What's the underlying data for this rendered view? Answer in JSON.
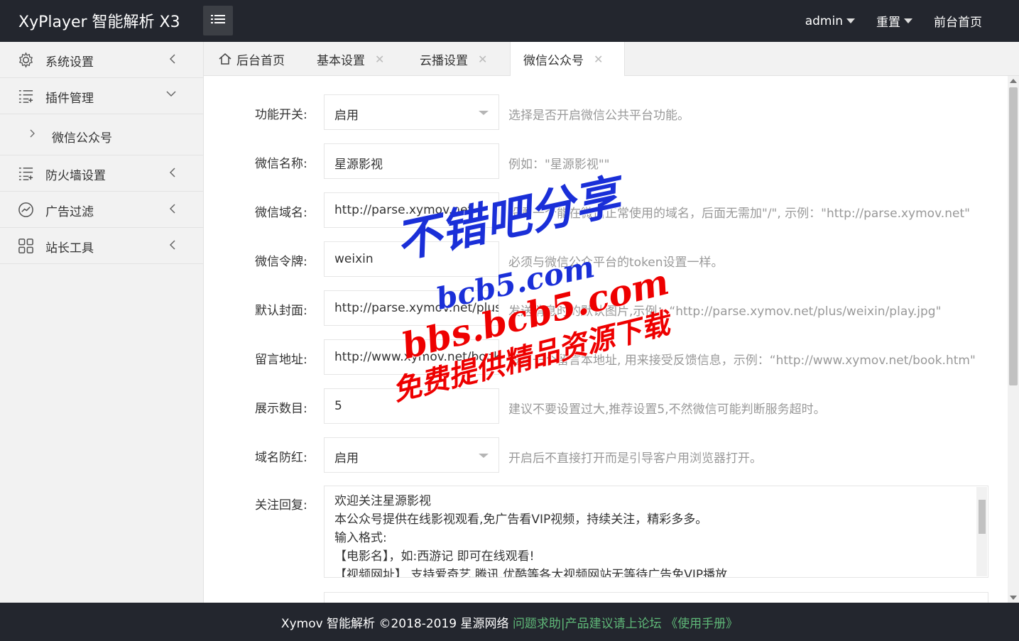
{
  "header": {
    "logo": "XyPlayer 智能解析 X3",
    "nav": [
      {
        "label": "admin",
        "has_caret": true
      },
      {
        "label": "重置",
        "has_caret": true
      },
      {
        "label": "前台首页",
        "has_caret": false
      }
    ]
  },
  "sidebar": {
    "items": [
      {
        "label": "系统设置",
        "icon": "gear-icon"
      },
      {
        "label": "插件管理",
        "icon": "list-icon"
      },
      {
        "label": "微信公众号",
        "icon": "chevron-right-icon"
      },
      {
        "label": "防火墙设置",
        "icon": "list-icon"
      },
      {
        "label": "广告过滤",
        "icon": "chart-icon"
      },
      {
        "label": "站长工具",
        "icon": "grid-icon"
      }
    ]
  },
  "tabs": [
    {
      "label": "后台首页",
      "icon": "home-icon"
    },
    {
      "label": "基本设置"
    },
    {
      "label": "云播设置"
    },
    {
      "label": "微信公众号",
      "active": true
    }
  ],
  "form": {
    "rows": [
      {
        "label": "功能开关:",
        "value": "启用",
        "type": "select",
        "hint": "选择是否开启微信公共平台功能。"
      },
      {
        "label": "微信名称:",
        "value": "星源影视",
        "type": "input",
        "hint": "例如：\"星源影视\"\""
      },
      {
        "label": "微信域名:",
        "value": "http://parse.xymov.net",
        "type": "input",
        "hint": "设置一个能在微信正常使用的域名，后面无需加\"/\", 示例：\"http://parse.xymov.net\""
      },
      {
        "label": "微信令牌:",
        "value": "weixin",
        "type": "input",
        "hint": "必须与微信公众平台的token设置一样。"
      },
      {
        "label": "默认封面:",
        "value": "http://parse.xymov.net/plus/weixin/play.jpg",
        "type": "input",
        "hint": "发送消息时的默认图片,示例：“http://parse.xymov.net/plus/weixin/play.jpg\""
      },
      {
        "label": "留言地址:",
        "value": "http://www.xymov.net/book.htm",
        "type": "input",
        "hint": "设置一个留言本地址, 用来接受反馈信息，示例：“http://www.xymov.net/book.htm\""
      },
      {
        "label": "展示数目:",
        "value": "5",
        "type": "input",
        "hint": "建议不要设置过大,推荐设置5,不然微信可能判断服务超时。"
      },
      {
        "label": "域名防红:",
        "value": "启用",
        "type": "select",
        "hint": "开启后不直接打开而是引导客户用浏览器打开。"
      }
    ],
    "reply_label": "关注回复:",
    "reply_lines": [
      "欢迎关注星源影视",
      "本公众号提供在线影视观看,免广告看VIP视频，持续关注，精彩多多。",
      "输入格式:",
      "【电影名】，如:西游记 即可在线观看!",
      "【视频网址】 支持爱奇艺,腾讯,优酷等各大视频网站无等待广告免VIP播放"
    ]
  },
  "footer": {
    "text": "Xymov 智能解析 ©2018-2019 星源网络",
    "link1": "问题求助|产品建议请上论坛",
    "link2": "《使用手册》"
  },
  "watermark": {
    "line1": "不错吧分享",
    "line2": "bcb5.com",
    "line3": "bbs.bcb5.com",
    "line4": "免费提供精品资源下载"
  }
}
